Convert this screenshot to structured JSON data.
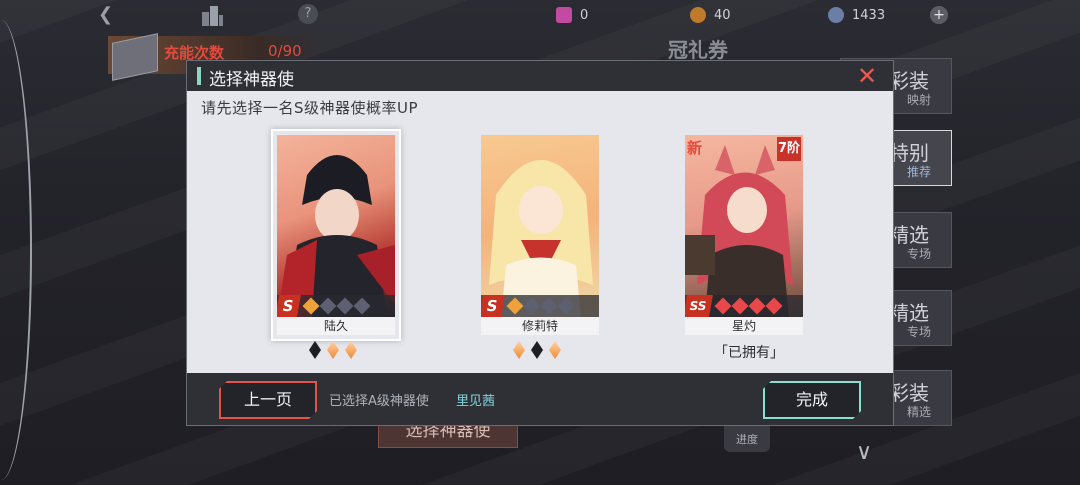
{
  "topbar": {
    "back_icon": "chevron-left-icon",
    "city_icon": "buildings-icon",
    "help_icon": "question-icon",
    "resources": [
      {
        "icon": "ticket-icon",
        "value": "0",
        "color": "#c24aa0"
      },
      {
        "icon": "coin-icon",
        "value": "40",
        "color": "#c07a2a"
      },
      {
        "icon": "crystal-icon",
        "value": "1433",
        "color": "#6b7fa6"
      }
    ],
    "plus_label": "+"
  },
  "charge": {
    "label": "充能次数",
    "count": "0/90"
  },
  "background": {
    "banner_title": "冠礼券",
    "side_buttons": [
      {
        "main": "彩装",
        "sub": "映射"
      },
      {
        "main": "特别",
        "sub": "推荐"
      },
      {
        "main": "精选",
        "sub": "专场"
      },
      {
        "main": "精选",
        "sub": "专场"
      },
      {
        "main": "彩装",
        "sub": "精选"
      }
    ],
    "select_button": "选择神器使",
    "progress_label": "进度"
  },
  "dialog": {
    "title": "选择神器使",
    "close_icon": "close-icon",
    "hint": "请先选择一名S级神器使概率UP",
    "cards": [
      {
        "name": "陆久",
        "rarity": "S",
        "selected": true,
        "stars_lit": 1,
        "stars_total": 4,
        "gems": [
          "black",
          "fire",
          "fire"
        ],
        "owned": ""
      },
      {
        "name": "修莉特",
        "rarity": "S",
        "selected": false,
        "stars_lit": 1,
        "stars_total": 4,
        "gems": [
          "fire",
          "black",
          "fire"
        ],
        "owned": ""
      },
      {
        "name": "星灼",
        "rarity": "SS",
        "selected": false,
        "stars_lit": 4,
        "stars_total": 4,
        "gems": [],
        "owned": "「已拥有」",
        "new_tag": "新",
        "level_tag": "7阶"
      }
    ],
    "footer": {
      "prev_label": "上一页",
      "selected_text": "已选择A级神器使",
      "selected_name": "里见茜",
      "done_label": "完成"
    }
  }
}
